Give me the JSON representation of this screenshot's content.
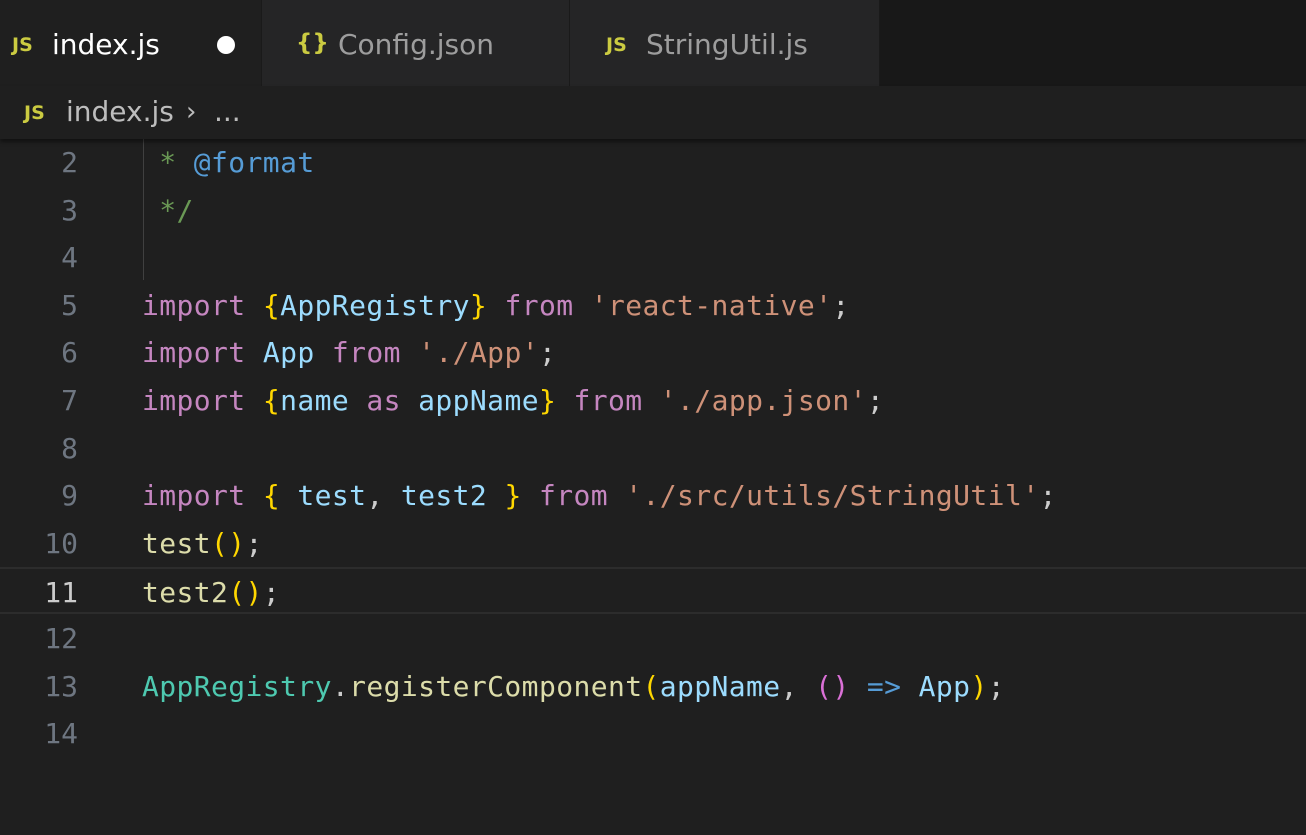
{
  "tabs": [
    {
      "icon": "JS",
      "icon_name": "js-file-icon",
      "label": "index.js",
      "active": true,
      "dirty": true
    },
    {
      "icon": "{}",
      "icon_name": "json-file-icon",
      "label": "Config.json",
      "active": false,
      "dirty": false
    },
    {
      "icon": "JS",
      "icon_name": "js-file-icon",
      "label": "StringUtil.js",
      "active": false,
      "dirty": false
    }
  ],
  "breadcrumb": {
    "icon": "JS",
    "file": "index.js",
    "separator": "›",
    "more": "..."
  },
  "editor": {
    "current_line": 11,
    "lines": [
      {
        "num": "2",
        "t": [
          [
            "cm",
            " * "
          ],
          [
            "tag",
            "@format"
          ]
        ]
      },
      {
        "num": "3",
        "t": [
          [
            "cm",
            " */"
          ]
        ]
      },
      {
        "num": "4",
        "t": []
      },
      {
        "num": "5",
        "t": [
          [
            "kw",
            "import"
          ],
          [
            "pn",
            " "
          ],
          [
            "br1",
            "{"
          ],
          [
            "var",
            "AppRegistry"
          ],
          [
            "br1",
            "}"
          ],
          [
            "pn",
            " "
          ],
          [
            "kw",
            "from"
          ],
          [
            "pn",
            " "
          ],
          [
            "str",
            "'react-native'"
          ],
          [
            "pn",
            ";"
          ]
        ]
      },
      {
        "num": "6",
        "t": [
          [
            "kw",
            "import"
          ],
          [
            "pn",
            " "
          ],
          [
            "var",
            "App"
          ],
          [
            "pn",
            " "
          ],
          [
            "kw",
            "from"
          ],
          [
            "pn",
            " "
          ],
          [
            "str",
            "'./App'"
          ],
          [
            "pn",
            ";"
          ]
        ]
      },
      {
        "num": "7",
        "t": [
          [
            "kw",
            "import"
          ],
          [
            "pn",
            " "
          ],
          [
            "br1",
            "{"
          ],
          [
            "var",
            "name"
          ],
          [
            "pn",
            " "
          ],
          [
            "kw",
            "as"
          ],
          [
            "pn",
            " "
          ],
          [
            "var",
            "appName"
          ],
          [
            "br1",
            "}"
          ],
          [
            "pn",
            " "
          ],
          [
            "kw",
            "from"
          ],
          [
            "pn",
            " "
          ],
          [
            "str",
            "'./app.json'"
          ],
          [
            "pn",
            ";"
          ]
        ]
      },
      {
        "num": "8",
        "t": []
      },
      {
        "num": "9",
        "t": [
          [
            "kw",
            "import"
          ],
          [
            "pn",
            " "
          ],
          [
            "br1",
            "{"
          ],
          [
            "pn",
            " "
          ],
          [
            "var",
            "test"
          ],
          [
            "pn",
            ", "
          ],
          [
            "var",
            "test2"
          ],
          [
            "pn",
            " "
          ],
          [
            "br1",
            "}"
          ],
          [
            "pn",
            " "
          ],
          [
            "kw",
            "from"
          ],
          [
            "pn",
            " "
          ],
          [
            "str",
            "'./src/utils/StringUtil'"
          ],
          [
            "pn",
            ";"
          ]
        ]
      },
      {
        "num": "10",
        "t": [
          [
            "fn",
            "test"
          ],
          [
            "br1",
            "()"
          ],
          [
            "pn",
            ";"
          ]
        ]
      },
      {
        "num": "11",
        "t": [
          [
            "fn",
            "test2"
          ],
          [
            "br1",
            "()"
          ],
          [
            "pn",
            ";"
          ]
        ]
      },
      {
        "num": "12",
        "t": []
      },
      {
        "num": "13",
        "t": [
          [
            "cls",
            "AppRegistry"
          ],
          [
            "pn",
            "."
          ],
          [
            "fn",
            "registerComponent"
          ],
          [
            "br1",
            "("
          ],
          [
            "var",
            "appName"
          ],
          [
            "pn",
            ", "
          ],
          [
            "br2",
            "()"
          ],
          [
            "pn",
            " "
          ],
          [
            "arrow",
            "=>"
          ],
          [
            "pn",
            " "
          ],
          [
            "var",
            "App"
          ],
          [
            "br1",
            ")"
          ],
          [
            "pn",
            ";"
          ]
        ]
      },
      {
        "num": "14",
        "t": []
      }
    ]
  },
  "colors": {
    "keyword": "#c586c0",
    "string": "#ce9178",
    "class": "#4ec9b0",
    "variable": "#9cdcfe",
    "function": "#dcdcaa",
    "bracket": "#ffd700",
    "js_icon": "#cbcb41"
  }
}
